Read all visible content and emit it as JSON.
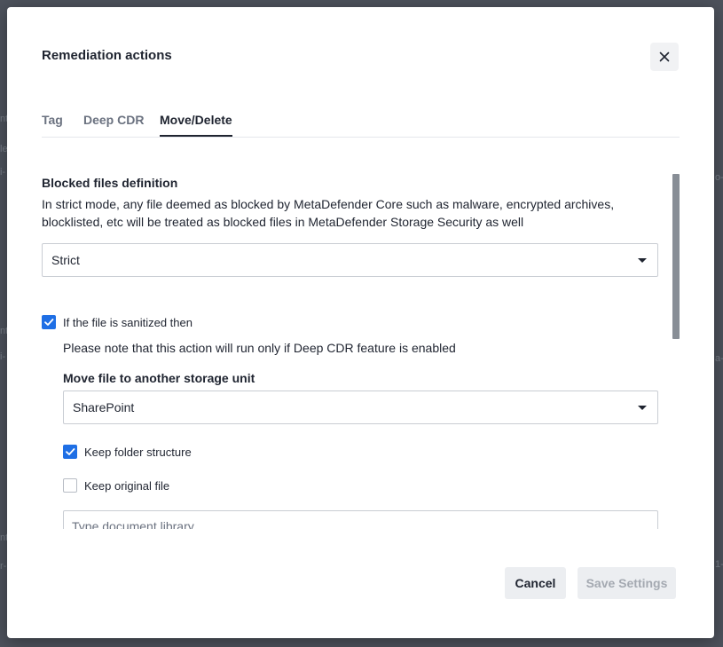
{
  "background": {
    "fragments": [
      "nt",
      "let",
      "i-",
      "o-",
      "a-",
      "nt",
      "i-",
      "nt",
      "r-",
      "1-"
    ]
  },
  "modal": {
    "title": "Remediation actions",
    "close_icon": "close-icon"
  },
  "tabs": [
    {
      "label": "Tag",
      "active": false
    },
    {
      "label": "Deep CDR",
      "active": false
    },
    {
      "label": "Move/Delete",
      "active": true
    }
  ],
  "blocked_files": {
    "heading": "Blocked files definition",
    "description": "In strict mode, any file deemed as blocked by MetaDefender Core such as malware, encrypted archives, blocklisted, etc will be treated as blocked files in MetaDefender Storage Security as well",
    "selected": "Strict"
  },
  "sanitized": {
    "checkbox_label": "If the file is sanitized then",
    "checked": true,
    "note": "Please note that this action will run only if Deep CDR feature is enabled",
    "move_heading": "Move file to another storage unit",
    "storage_selected": "SharePoint",
    "keep_folder_label": "Keep folder structure",
    "keep_folder_checked": true,
    "keep_original_label": "Keep original file",
    "keep_original_checked": false,
    "library_placeholder": "Type document library ..."
  },
  "footer": {
    "cancel_label": "Cancel",
    "save_label": "Save Settings"
  },
  "colors": {
    "accent": "#1f6fe5",
    "overlay": "#4d525c"
  }
}
